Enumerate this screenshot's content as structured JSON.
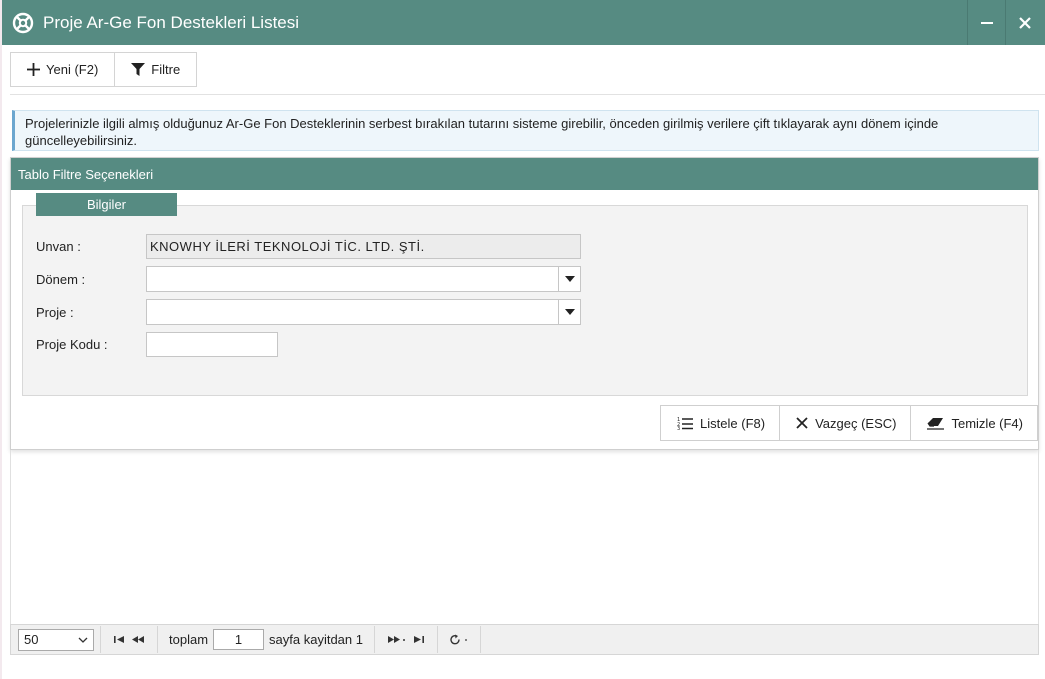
{
  "window": {
    "title": "Proje Ar-Ge Fon Destekleri Listesi"
  },
  "toolbar": {
    "new_label": "Yeni (F2)",
    "filter_label": "Filtre"
  },
  "info": {
    "text": "Projelerinizle ilgili almış olduğunuz Ar-Ge Fon Desteklerinin serbest bırakılan tutarını sisteme girebilir, önceden girilmiş verilere çift tıklayarak aynı dönem içinde güncelleyebilirsiniz."
  },
  "filter_panel": {
    "title": "Tablo Filtre Seçenekleri",
    "group_title": "Bilgiler",
    "unvan_label": "Unvan :",
    "unvan_value": "KNOWHY İLERİ TEKNOLOJİ TİC. LTD. ŞTİ.",
    "donem_label": "Dönem :",
    "donem_value": "",
    "proje_label": "Proje :",
    "proje_value": "",
    "proje_kodu_label": "Proje Kodu :",
    "proje_kodu_value": ""
  },
  "actions": {
    "list_label": "Listele (F8)",
    "cancel_label": "Vazgeç (ESC)",
    "clear_label": "Temizle (F4)"
  },
  "pager": {
    "page_size": "50",
    "total_label": "toplam",
    "page_value": "1",
    "page_suffix": "sayfa kayitdan 1"
  },
  "colors": {
    "accent": "#568b82",
    "info_bg": "#eef6fb",
    "info_border": "#6ba6cf"
  }
}
